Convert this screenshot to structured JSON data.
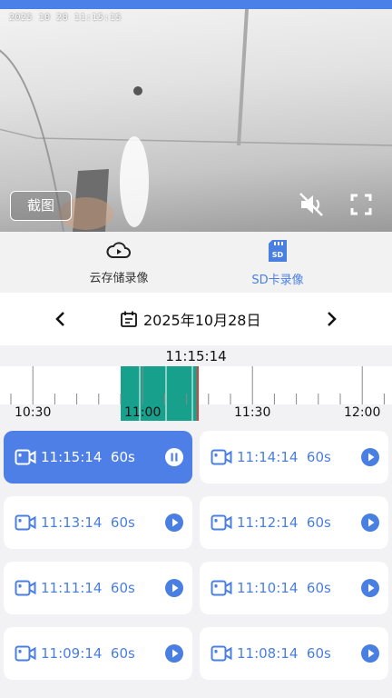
{
  "video": {
    "osd_timestamp": "2025 10 28  11:15:15",
    "snapshot_label": "截图",
    "muted": true
  },
  "modes": [
    {
      "label": "云存储录像",
      "icon": "cloud-play-icon",
      "active": false
    },
    {
      "label": "SD卡录像",
      "icon": "sd-card-icon",
      "active": true
    }
  ],
  "date": {
    "label": "2025年10月28日"
  },
  "timeline": {
    "current_time": "11:15:14",
    "tick_labels": [
      "10:30",
      "11:00",
      "11:30",
      "12:00"
    ],
    "recorded_color": "#17a08c",
    "cursor_color": "#e23b3b"
  },
  "recordings": [
    {
      "time": "11:15:14",
      "duration": "60s",
      "playing": true
    },
    {
      "time": "11:14:14",
      "duration": "60s",
      "playing": false
    },
    {
      "time": "11:13:14",
      "duration": "60s",
      "playing": false
    },
    {
      "time": "11:12:14",
      "duration": "60s",
      "playing": false
    },
    {
      "time": "11:11:14",
      "duration": "60s",
      "playing": false
    },
    {
      "time": "11:10:14",
      "duration": "60s",
      "playing": false
    },
    {
      "time": "11:09:14",
      "duration": "60s",
      "playing": false
    },
    {
      "time": "11:08:14",
      "duration": "60s",
      "playing": false
    }
  ],
  "colors": {
    "accent": "#4a7fe2",
    "top_bar": "#4a80e8"
  }
}
